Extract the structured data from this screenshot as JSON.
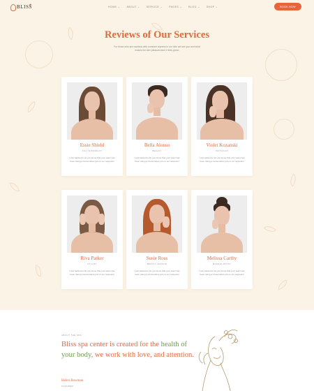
{
  "brand": {
    "name": "BLISS"
  },
  "nav": [
    {
      "label": "HOME"
    },
    {
      "label": "ABOUT"
    },
    {
      "label": "SERVICE"
    },
    {
      "label": "PAGES"
    },
    {
      "label": "BLOG"
    },
    {
      "label": "SHOP"
    }
  ],
  "header": {
    "book_label": "BOOK NOW"
  },
  "section": {
    "title": "Reviews of Our Services",
    "subtitle": "For those who are cautious with constant dryness in our skin we see you and what makes the skin pleasant and it feels great."
  },
  "reviews": [
    {
      "name": "Essie Shield",
      "role": "FILL IN PRODUCT",
      "quote": "I just wanted to let you know that your team has been doing a tremendous job on our requests!"
    },
    {
      "name": "Bella Alonso",
      "role": "BEAUTY",
      "quote": "I just wanted to let you know that your team has been doing a tremendous job on our requests!"
    },
    {
      "name": "Violet Kozanski",
      "role": "PHYSICIAN",
      "quote": "I just wanted to let you know that your team has been doing a tremendous job on our requests!"
    },
    {
      "name": "Riva Parker",
      "role": "STYLIST",
      "quote": "I just wanted to let you know that your team has been doing a tremendous job on our requests!"
    },
    {
      "name": "Susie Ross",
      "role": "BEAUTY ADVISOR",
      "quote": "I just wanted to let you know that your team has been doing a tremendous job on our requests!"
    },
    {
      "name": "Melissa Carthy",
      "role": "MAKEUP ARTIST",
      "quote": "I just wanted to let you know that your team has been doing a tremendous job on our requests!"
    }
  ],
  "about": {
    "label": "ABOUT THE SPA",
    "text_start": "Bliss spa center is created for the ",
    "text_highlight": "health of your body",
    "text_end": ", we work with love, and attention.",
    "signature_name": "Helen Bowman",
    "signature_role": "FOUNDER"
  },
  "colors": {
    "accent": "#e4693f",
    "highlight": "#6a9e4c",
    "background": "#fbf4e6",
    "button": "#e8643a"
  }
}
